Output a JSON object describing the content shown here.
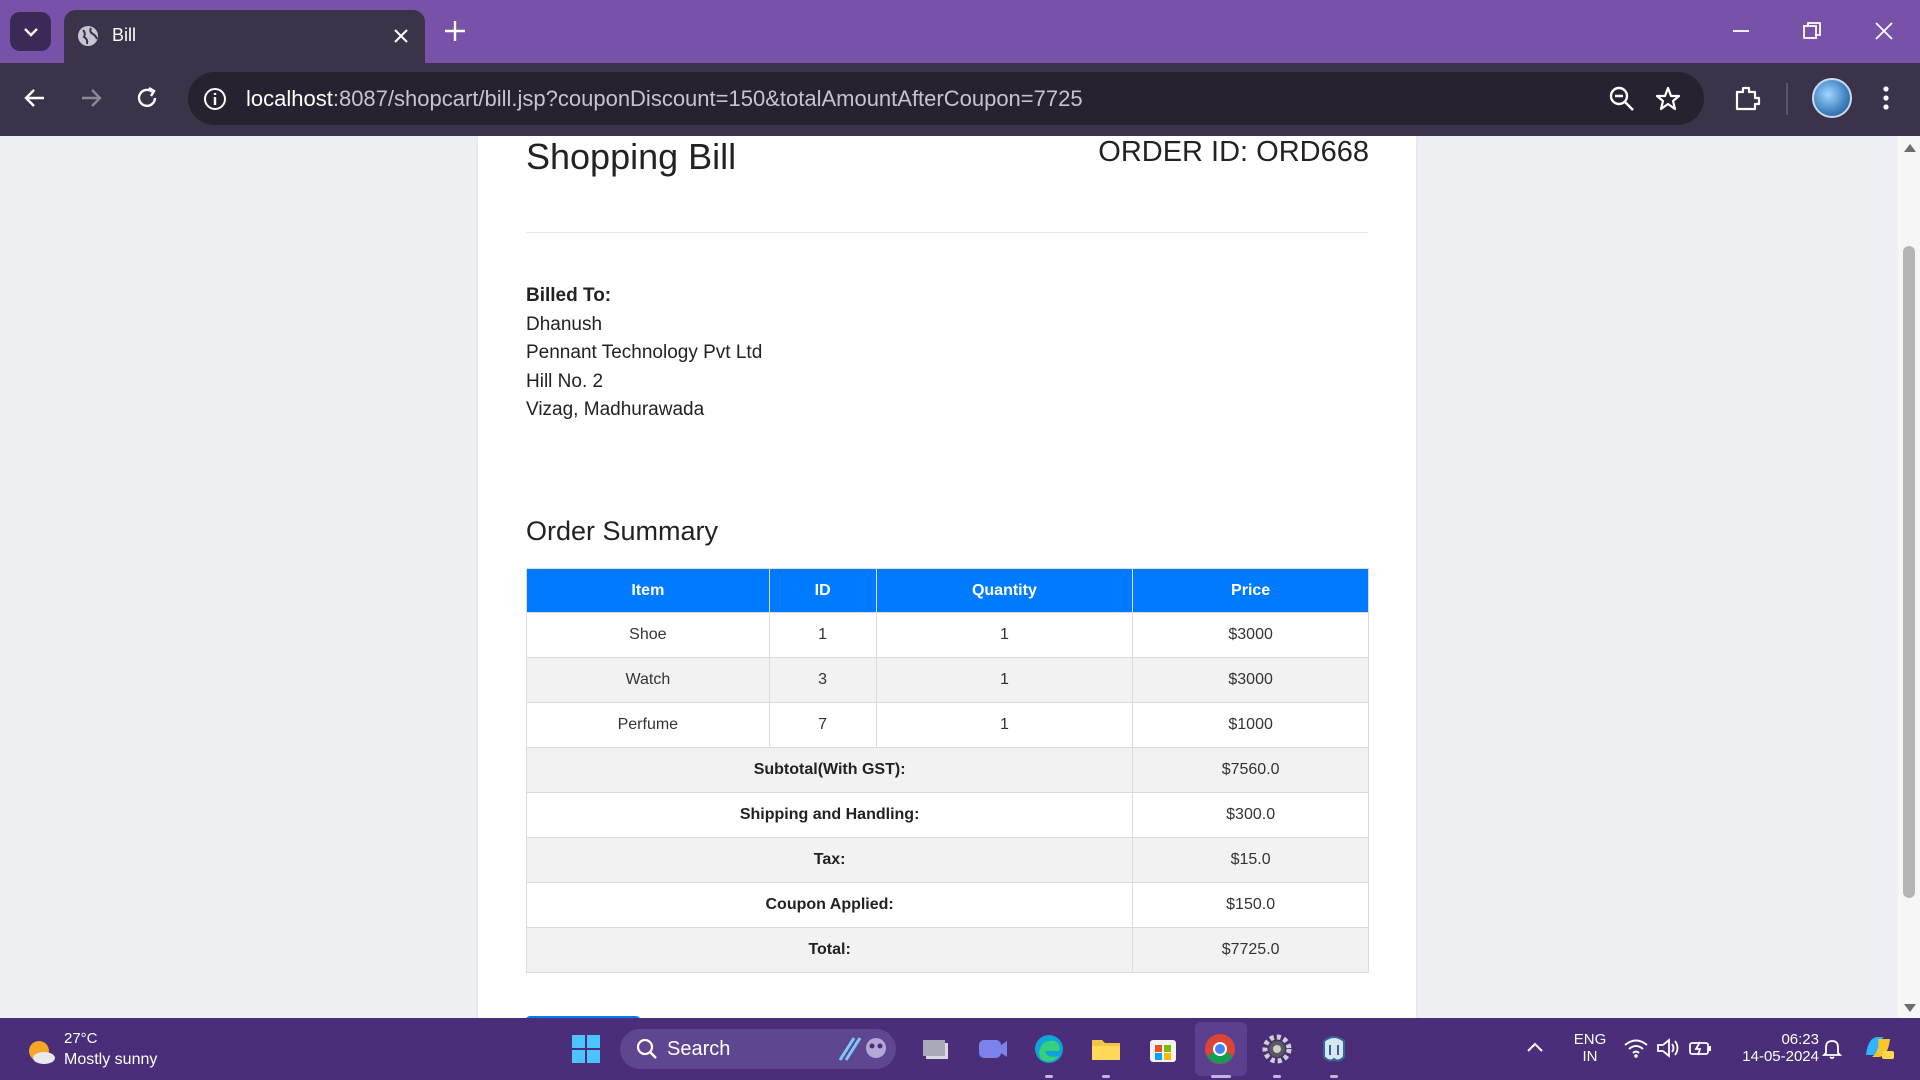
{
  "browser": {
    "tab_title": "Bill",
    "url_host": "localhost",
    "url_rest": ":8087/shopcart/bill.jsp?couponDiscount=150&totalAmountAfterCoupon=7725",
    "accent_color": "#7851a9"
  },
  "page": {
    "title": "Shopping Bill",
    "order_id": "ORDER ID: ORD668",
    "billed_to": {
      "label": "Billed To:",
      "name": "Dhanush",
      "company": "Pennant Technology Pvt Ltd",
      "address1": "Hill No. 2",
      "address2": "Vizag, Madhurawada"
    },
    "summary_title": "Order Summary",
    "table": {
      "headers": [
        "Item",
        "ID",
        "Quantity",
        "Price"
      ],
      "header_color": "#007bff",
      "rows": [
        [
          "Shoe",
          "1",
          "1",
          "$3000"
        ],
        [
          "Watch",
          "3",
          "1",
          "$3000"
        ],
        [
          "Perfume",
          "7",
          "1",
          "$1000"
        ]
      ],
      "totals": [
        {
          "label": "Subtotal(With GST):",
          "value": "$7560.0"
        },
        {
          "label": "Shipping and Handling:",
          "value": "$300.0"
        },
        {
          "label": "Tax:",
          "value": "$15.0"
        },
        {
          "label": "Coupon Applied:",
          "value": "$150.0"
        },
        {
          "label": "Total:",
          "value": "$7725.0"
        }
      ]
    }
  },
  "taskbar": {
    "weather_temp": "27°C",
    "weather_cond": "Mostly sunny",
    "search_label": "Search",
    "lang_1": "ENG",
    "lang_2": "IN",
    "time": "06:23",
    "date": "14-05-2024"
  }
}
